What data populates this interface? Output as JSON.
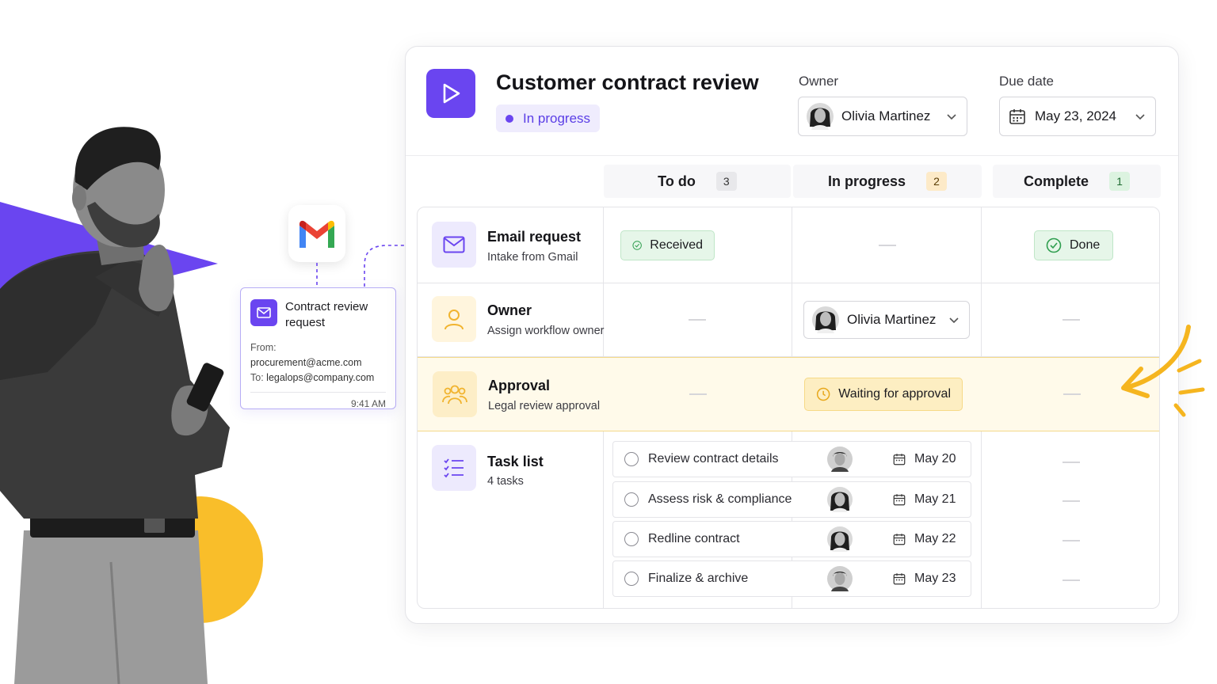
{
  "theme": {
    "accent": "#6a45f0",
    "warning": "#f5c22b",
    "success": "#2f9e4f"
  },
  "gmail_card": {
    "title": "Contract review request",
    "from_label": "From:",
    "from_value": "procurement@acme.com",
    "to_label": "To:",
    "to_value": "legalops@company.com",
    "time": "9:41 AM",
    "icons": [
      "gmail-logo",
      "mail-icon"
    ]
  },
  "workflow": {
    "title": "Customer contract review",
    "status": "In progress",
    "owner_label": "Owner",
    "owner_value": "Olivia Martinez",
    "due_label": "Due date",
    "due_value": "May 23, 2024"
  },
  "columns": [
    {
      "label": "To do",
      "count": "3"
    },
    {
      "label": "In progress",
      "count": "2"
    },
    {
      "label": "Complete",
      "count": "1"
    }
  ],
  "rows": {
    "email": {
      "title": "Email request",
      "subtitle": "Intake from Gmail",
      "todo_badge": "Received",
      "complete_badge": "Done"
    },
    "owner": {
      "title": "Owner",
      "subtitle": "Assign workflow owner",
      "in_progress_value": "Olivia Martinez"
    },
    "approval": {
      "title": "Approval",
      "subtitle": "Legal review approval",
      "in_progress_badge": "Waiting for approval"
    },
    "tasks": {
      "title": "Task list",
      "subtitle": "4 tasks",
      "items": [
        {
          "name": "Review contract details",
          "date": "May 20"
        },
        {
          "name": "Assess risk & compliance",
          "date": "May 21"
        },
        {
          "name": "Redline contract",
          "date": "May 22"
        },
        {
          "name": "Finalize & archive",
          "date": "May 23"
        }
      ]
    }
  }
}
